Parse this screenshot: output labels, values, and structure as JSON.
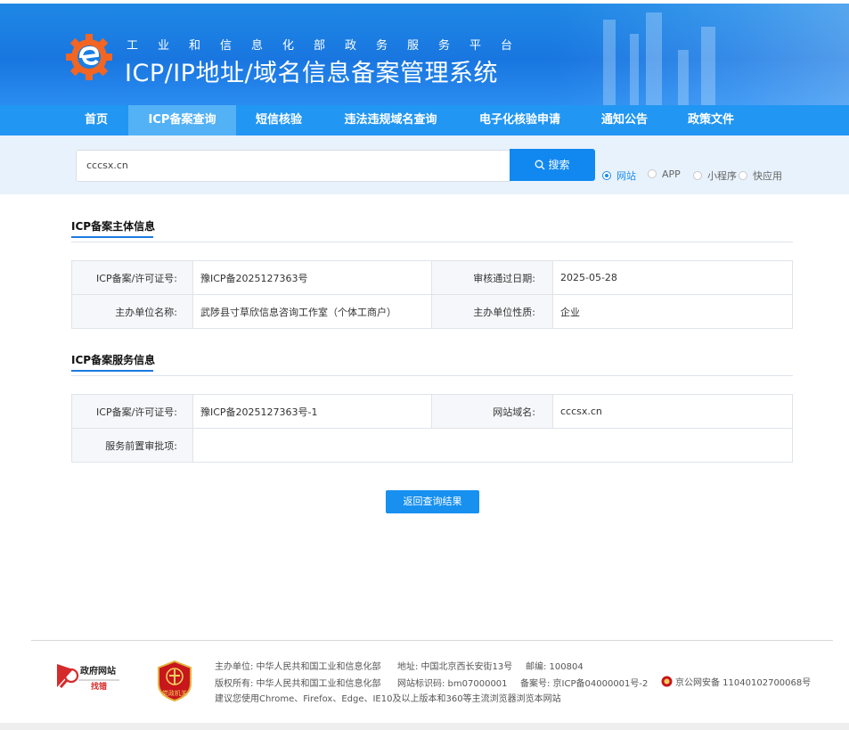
{
  "header": {
    "subtitle": "工业和信息化部政务服务平台",
    "title": "ICP/IP地址/域名信息备案管理系统"
  },
  "nav": {
    "items": [
      "首页",
      "ICP备案查询",
      "短信核验",
      "违法违规域名查询",
      "电子化核验申请",
      "通知公告",
      "政策文件"
    ],
    "active_index": 1
  },
  "search": {
    "value": "cccsx.cn",
    "button_label": "搜索",
    "options": [
      "网站",
      "APP",
      "小程序",
      "快应用"
    ],
    "selected_option": "网站"
  },
  "subject_section": {
    "title": "ICP备案主体信息",
    "rows": [
      {
        "label1": "ICP备案/许可证号:",
        "value1": "豫ICP备2025127363号",
        "label2": "审核通过日期:",
        "value2": "2025-05-28"
      },
      {
        "label1": "主办单位名称:",
        "value1": "武陟县寸草欣信息咨询工作室（个体工商户）",
        "label2": "主办单位性质:",
        "value2": "企业"
      }
    ]
  },
  "service_section": {
    "title": "ICP备案服务信息",
    "row1": {
      "label1": "ICP备案/许可证号:",
      "value1": "豫ICP备2025127363号-1",
      "label2": "网站域名:",
      "value2": "cccsx.cn"
    },
    "row2": {
      "label": "服务前置审批项:",
      "value": ""
    }
  },
  "back_button": "返回查询结果",
  "footer": {
    "gov_logo_text_top": "政府网站",
    "gov_logo_text_bottom": "找错",
    "sponsor": "主办单位:  中华人民共和国工业和信息化部",
    "address": "地址: 中国北京西长安街13号",
    "postcode": "邮编: 100804",
    "copyright": "版权所有:  中华人民共和国工业和信息化部",
    "site_code": "网站标识码:  bm07000001",
    "icp_record": "备案号: 京ICP备04000001号-2",
    "police_record": "京公网安备 11040102700068号",
    "browser_tip": "建议您使用Chrome、Firefox、Edge、IE10及以上版本和360等主流浏览器浏览本网站",
    "badge_text": "党政机关"
  },
  "colors": {
    "header_blue": "#1976e0",
    "nav_blue": "#2196f3",
    "nav_active": "#53b1f5",
    "accent": "#1188f0"
  }
}
